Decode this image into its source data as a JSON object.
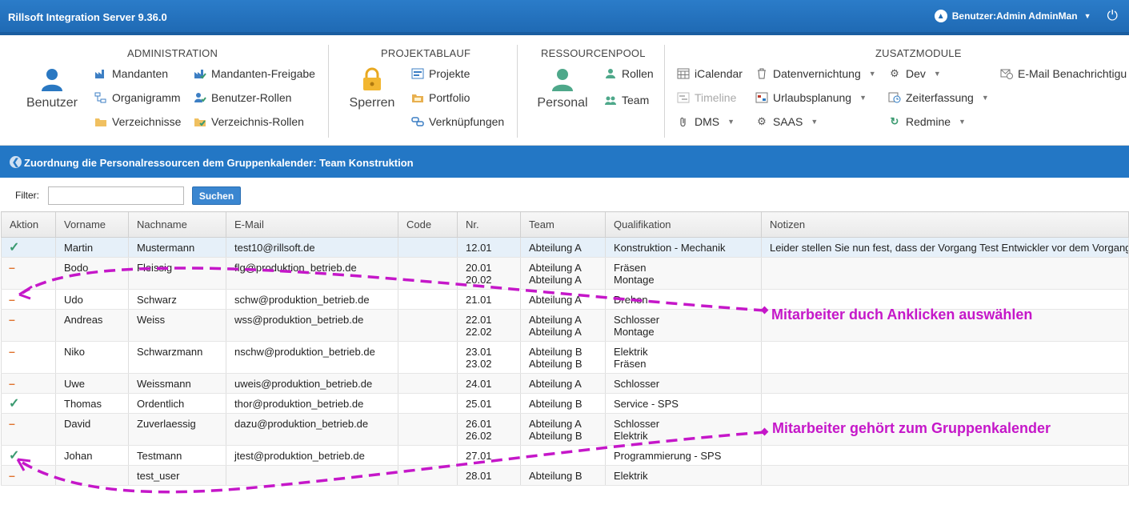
{
  "app": {
    "title": "Rillsoft Integration Server 9.36.0",
    "user_label": "Benutzer:Admin AdminMan"
  },
  "ribbon": {
    "administration": {
      "title": "ADMINISTRATION",
      "big_label": "Benutzer",
      "items": [
        "Mandanten",
        "Organigramm",
        "Verzeichnisse",
        "Mandanten-Freigabe",
        "Benutzer-Rollen",
        "Verzeichnis-Rollen"
      ]
    },
    "projektablauf": {
      "title": "PROJEKTABLAUF",
      "big_label": "Sperren",
      "items": [
        "Projekte",
        "Portfolio",
        "Verknüpfungen"
      ]
    },
    "ressourcenpool": {
      "title": "RESSOURCENPOOL",
      "big_label": "Personal",
      "items": [
        "Rollen",
        "Team"
      ]
    },
    "zusatzmodule": {
      "title": "ZUSATZMODULE",
      "items": [
        "iCalendar",
        "Timeline",
        "DMS",
        "Datenvernichtung",
        "Urlaubsplanung",
        "SAAS",
        "Dev",
        "Zeiterfassung",
        "Redmine",
        "E-Mail Benachrichtigu"
      ]
    }
  },
  "section": {
    "title": "Zuordnung die Personalressourcen dem Gruppenkalender: Team Konstruktion"
  },
  "filter": {
    "label": "Filter:",
    "value": "",
    "button": "Suchen"
  },
  "table": {
    "columns": [
      "Aktion",
      "Vorname",
      "Nachname",
      "E-Mail",
      "Code",
      "Nr.",
      "Team",
      "Qualifikation",
      "Notizen"
    ],
    "rows": [
      {
        "aktion": "check",
        "vorname": "Martin",
        "nachname": "Mustermann",
        "email": "test10@rillsoft.de",
        "code": "",
        "nr": "12.01",
        "team": "Abteilung A",
        "qual": "Konstruktion - Mechanik",
        "notizen": "Leider stellen Sie nun fest, dass der Vorgang Test Entwickler vor dem Vorgang"
      },
      {
        "aktion": "minus",
        "vorname": "Bodo",
        "nachname": "Fleissig",
        "email": "flg@produktion_betrieb.de",
        "code": "",
        "nr": "20.01\n20.02",
        "team": "Abteilung A\nAbteilung A",
        "qual": "Fräsen\nMontage",
        "notizen": ""
      },
      {
        "aktion": "minus",
        "vorname": "Udo",
        "nachname": "Schwarz",
        "email": "schw@produktion_betrieb.de",
        "code": "",
        "nr": "21.01",
        "team": "Abteilung A",
        "qual": "Drehen",
        "notizen": ""
      },
      {
        "aktion": "minus",
        "vorname": "Andreas",
        "nachname": "Weiss",
        "email": "wss@produktion_betrieb.de",
        "code": "",
        "nr": "22.01\n22.02",
        "team": "Abteilung A\nAbteilung A",
        "qual": "Schlosser\nMontage",
        "notizen": ""
      },
      {
        "aktion": "minus",
        "vorname": "Niko",
        "nachname": "Schwarzmann",
        "email": "nschw@produktion_betrieb.de",
        "code": "",
        "nr": "23.01\n23.02",
        "team": "Abteilung B\nAbteilung B",
        "qual": "Elektrik\nFräsen",
        "notizen": ""
      },
      {
        "aktion": "minus",
        "vorname": "Uwe",
        "nachname": "Weissmann",
        "email": "uweis@produktion_betrieb.de",
        "code": "",
        "nr": "24.01",
        "team": "Abteilung A",
        "qual": "Schlosser",
        "notizen": ""
      },
      {
        "aktion": "check",
        "vorname": "Thomas",
        "nachname": "Ordentlich",
        "email": "thor@produktion_betrieb.de",
        "code": "",
        "nr": "25.01",
        "team": "Abteilung B",
        "qual": "Service - SPS",
        "notizen": ""
      },
      {
        "aktion": "minus",
        "vorname": "David",
        "nachname": "Zuverlaessig",
        "email": "dazu@produktion_betrieb.de",
        "code": "",
        "nr": "26.01\n26.02",
        "team": "Abteilung A\nAbteilung B",
        "qual": "Schlosser\nElektrik",
        "notizen": ""
      },
      {
        "aktion": "check",
        "vorname": "Johan",
        "nachname": "Testmann",
        "email": "jtest@produktion_betrieb.de",
        "code": "",
        "nr": "27.01",
        "team": "",
        "qual": "Programmierung - SPS",
        "notizen": ""
      },
      {
        "aktion": "minus",
        "vorname": "",
        "nachname": "test_user",
        "email": "",
        "code": "",
        "nr": "28.01",
        "team": "Abteilung B",
        "qual": "Elektrik",
        "notizen": ""
      }
    ]
  },
  "annotations": {
    "select_hint": "Mitarbeiter duch Anklicken auswählen",
    "member_hint": "Mitarbeiter gehört zum Gruppenkalender",
    "color": "#c517c9"
  },
  "colors": {
    "header_blue": "#2377c5",
    "check_green": "#3a9a70",
    "minus_orange": "#e0722d"
  }
}
